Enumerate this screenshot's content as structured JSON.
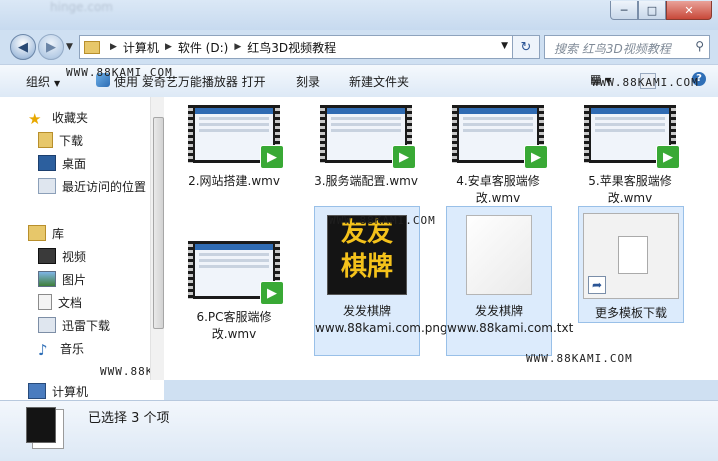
{
  "window": {
    "blurred_title": "hinge.com"
  },
  "address_bar": {
    "crumbs": [
      "计算机",
      "软件 (D:)",
      "红鸟3D视频教程"
    ]
  },
  "search": {
    "placeholder": "搜索 红鸟3D视频教程"
  },
  "toolbar": {
    "organize": "组织",
    "open_with": "使用 爱奇艺万能播放器 打开",
    "burn": "刻录",
    "new_folder": "新建文件夹"
  },
  "watermark": "WWW.88KAMI.COM",
  "nav": {
    "favorites": "收藏夹",
    "downloads": "下载",
    "desktop": "桌面",
    "recent": "最近访问的位置",
    "libraries": "库",
    "videos": "视频",
    "pictures": "图片",
    "documents": "文档",
    "xunlei": "迅雷下载",
    "music": "音乐",
    "computer": "计算机"
  },
  "files": [
    {
      "name": "2.网站搭建.wmv",
      "type": "video"
    },
    {
      "name": "3.服务端配置.wmv",
      "type": "video"
    },
    {
      "name": "4.安卓客服端修改.wmv",
      "type": "video"
    },
    {
      "name": "5.苹果客服端修改.wmv",
      "type": "video"
    },
    {
      "name": "6.PC客服端修改.wmv",
      "type": "video"
    },
    {
      "name": "发发棋牌www.88kami.com.png",
      "type": "image",
      "image_text": [
        "友友",
        "棋牌"
      ]
    },
    {
      "name": "发发棋牌www.88kami.com.txt",
      "type": "text"
    },
    {
      "name": "更多模板下载",
      "type": "shortcut"
    }
  ],
  "status": {
    "text": "已选择 3 个项"
  },
  "colors": {
    "selection": "#dcebfc",
    "accent": "#2f6bb3",
    "badge": "#39a935"
  }
}
